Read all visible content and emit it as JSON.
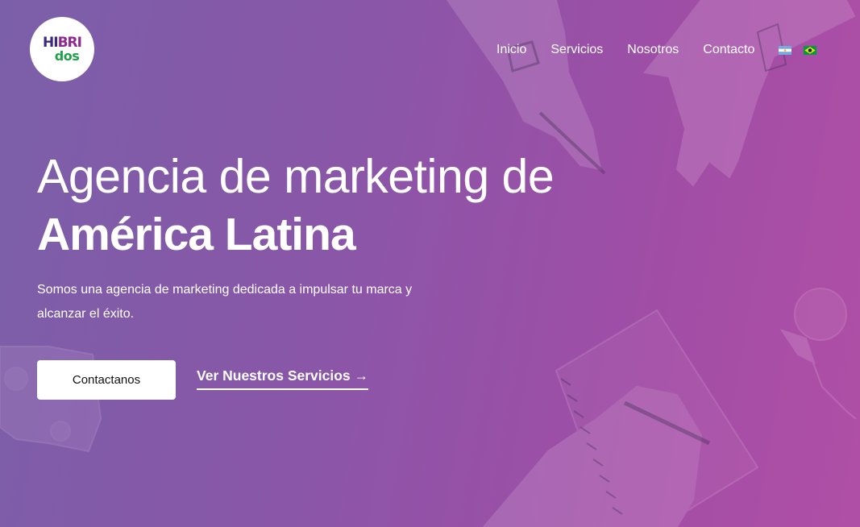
{
  "brand": {
    "logo_top_a": "HI",
    "logo_top_b": "BRI",
    "logo_bottom": "dos"
  },
  "nav": {
    "items": [
      {
        "label": "Inicio"
      },
      {
        "label": "Servicios"
      },
      {
        "label": "Nosotros"
      },
      {
        "label": "Contacto"
      }
    ],
    "languages": [
      {
        "icon": "argentina-flag-icon"
      },
      {
        "icon": "brazil-flag-icon"
      }
    ]
  },
  "hero": {
    "title_line1": "Agencia de marketing de",
    "title_line2": "América Latina",
    "subtitle": "Somos una agencia de marketing dedicada a impulsar tu marca y alcanzar el éxito.",
    "primary_cta": "Contactanos",
    "secondary_cta": "Ver Nuestros Servicios →"
  },
  "colors": {
    "overlay_start": "#7b5fa9",
    "overlay_end": "#b04fa6",
    "logo_purple": "#3b2a7a",
    "logo_magenta": "#8e2a8f",
    "logo_green": "#20a04a",
    "button_bg": "#ffffff"
  }
}
